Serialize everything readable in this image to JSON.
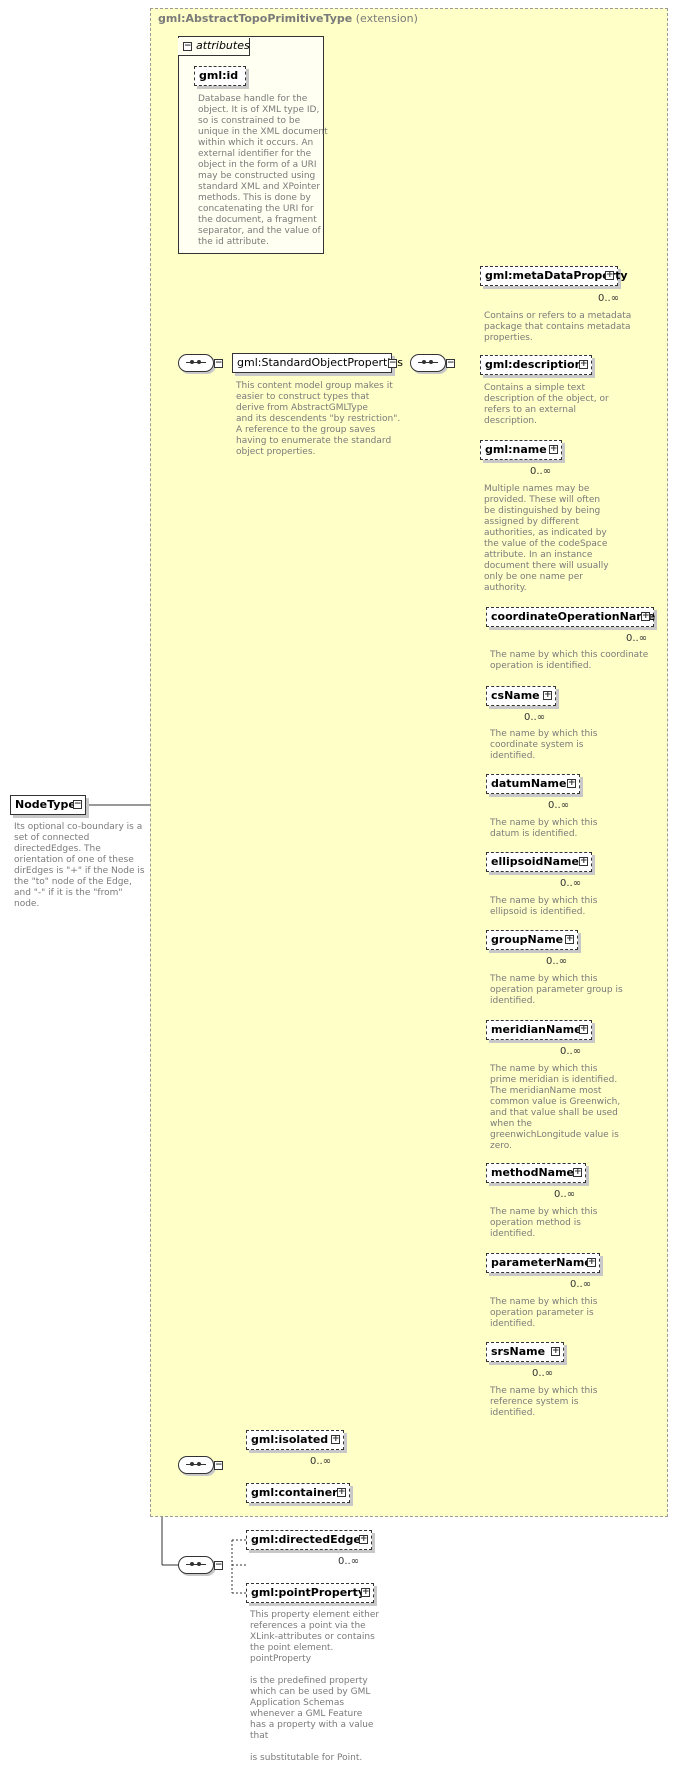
{
  "extension": {
    "type_name": "gml:AbstractTopoPrimitiveType",
    "kind": "(extension)"
  },
  "attributes": {
    "header": "attributes",
    "id_label": "gml:id",
    "id_desc": "Database handle for the\nobject.  It is of XML type ID,\nso is constrained to be\nunique in the XML document\nwithin which it occurs.  An\nexternal identifier for the\nobject in the form of a URI\nmay be constructed using\nstandard XML and XPointer\nmethods.  This is done by\nconcatenating the URI for\nthe document, a fragment\nseparator, and the value of\nthe id attribute."
  },
  "root": {
    "label": "NodeType",
    "desc": "Its optional co-boundary is a\nset of connected\ndirectedEdges.  The\norientation of one of these\ndirEdges is \"+\" if the Node is\nthe \"to\" node of the Edge,\nand \"-\" if it is the \"from\"\nnode."
  },
  "std_group": {
    "label": "gml:StandardObjectProperties",
    "desc": "This content model group makes it\neasier to construct types that\n        derive from AbstractGMLType\nand its descendents \"by restriction\".\n        A reference to the group saves\nhaving to enumerate the standard\nobject properties."
  },
  "elements": {
    "metaDataProperty": {
      "label": "gml:metaDataProperty",
      "card": "0..∞",
      "desc": "Contains or refers to a metadata\npackage that contains metadata\nproperties."
    },
    "description": {
      "label": "gml:description",
      "desc": "Contains a simple text\ndescription of the object, or\nrefers to an external\ndescription."
    },
    "name": {
      "label": "gml:name",
      "card": "0..∞",
      "desc": "Multiple names may be\nprovided.  These will often\nbe distinguished by being\nassigned by different\nauthorities, as indicated by\nthe value of the codeSpace\nattribute.  In an instance\ndocument there will usually\nonly be one name per\nauthority."
    },
    "coordinateOperationName": {
      "label": "coordinateOperationName",
      "card": "0..∞",
      "desc": "The name by which this coordinate\noperation is identified."
    },
    "csName": {
      "label": "csName",
      "card": "0..∞",
      "desc": "The name by which this\ncoordinate system is\nidentified."
    },
    "datumName": {
      "label": "datumName",
      "card": "0..∞",
      "desc": "The name by which this\ndatum is identified."
    },
    "ellipsoidName": {
      "label": "ellipsoidName",
      "card": "0..∞",
      "desc": "The name by which this\nellipsoid is identified."
    },
    "groupName": {
      "label": "groupName",
      "card": "0..∞",
      "desc": "The name by which this\noperation parameter group is\nidentified."
    },
    "meridianName": {
      "label": "meridianName",
      "card": "0..∞",
      "desc": "The name by which this\nprime meridian is identified.\nThe meridianName most\ncommon value is Greenwich,\nand that value shall be used\nwhen the\ngreenwichLongitude value is\nzero."
    },
    "methodName": {
      "label": "methodName",
      "card": "0..∞",
      "desc": "The name by which this\noperation method is\nidentified."
    },
    "parameterName": {
      "label": "parameterName",
      "card": "0..∞",
      "desc": "The name by which this\noperation parameter is\nidentified."
    },
    "srsName": {
      "label": "srsName",
      "card": "0..∞",
      "desc": "The name by which this\nreference system is\nidentified."
    },
    "isolated": {
      "label": "gml:isolated",
      "card": "0..∞"
    },
    "container": {
      "label": "gml:container"
    },
    "directedEdge": {
      "label": "gml:directedEdge",
      "card": "0..∞"
    },
    "pointProperty": {
      "label": "gml:pointProperty",
      "desc": "This property element either\nreferences a point via the\nXLink-attributes or contains\nthe point element.\npointProperty\n\nis the predefined property\nwhich can be used by GML\nApplication Schemas\nwhenever a GML Feature\nhas a property with a value\nthat\n\nis substitutable for Point."
    }
  },
  "icons": {
    "expand": "+",
    "collapse": "−"
  }
}
